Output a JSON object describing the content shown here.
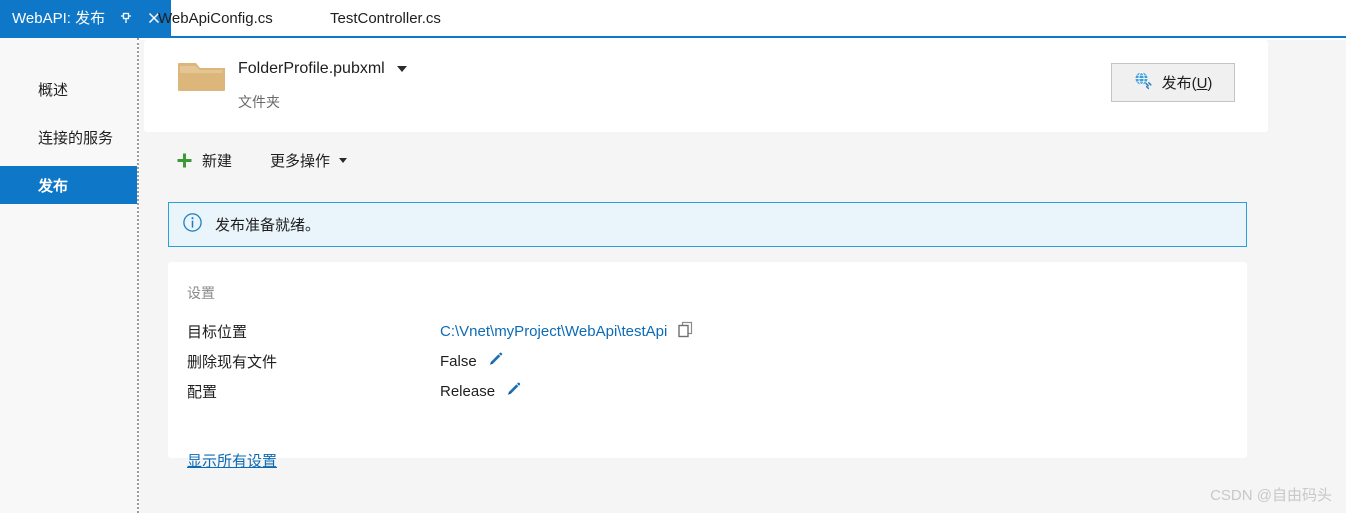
{
  "tabs": [
    {
      "label": "WebAPI: 发布",
      "active": true,
      "pin_icon": "pin-icon",
      "close_icon": "close-icon"
    },
    {
      "label": "WebApiConfig.cs",
      "active": false
    },
    {
      "label": "TestController.cs",
      "active": false
    }
  ],
  "sidebar": {
    "items": [
      {
        "label": "概述",
        "selected": false
      },
      {
        "label": "连接的服务",
        "selected": false
      },
      {
        "label": "发布",
        "selected": true
      }
    ]
  },
  "profile": {
    "icon": "folder-icon",
    "name": "FolderProfile.pubxml",
    "subtitle": "文件夹",
    "dropdown_icon": "chevron-down-icon"
  },
  "publish_button": {
    "icon": "web-publish-icon",
    "label_before": "发布(",
    "accelerator": "U",
    "label_after": ")"
  },
  "toolbar": {
    "new_label": "新建",
    "new_icon": "plus-icon",
    "more_actions_label": "更多操作",
    "more_actions_icon": "chevron-down-icon"
  },
  "banner": {
    "icon": "info-circle-icon",
    "text": "发布准备就绪。"
  },
  "settings": {
    "title": "设置",
    "rows": [
      {
        "key": "目标位置",
        "value": "C:\\Vnet\\myProject\\WebApi\\testApi",
        "value_is_link": true,
        "action_icon": "copy-icon"
      },
      {
        "key": "删除现有文件",
        "value": "False",
        "value_is_link": false,
        "action_icon": "pencil-edit-icon"
      },
      {
        "key": "配置",
        "value": "Release",
        "value_is_link": false,
        "action_icon": "pencil-edit-icon"
      }
    ],
    "show_all_label": "显示所有设置"
  },
  "watermark": "CSDN @自由码头",
  "colors": {
    "accent_blue": "#0e77c8",
    "link_blue": "#0d6bb5",
    "banner_border": "#2a9fe0",
    "banner_bg": "#eaf4fb",
    "folder_tan": "#dcb67a",
    "plus_green": "#3a9b35",
    "page_bg": "#f5f5f5"
  }
}
